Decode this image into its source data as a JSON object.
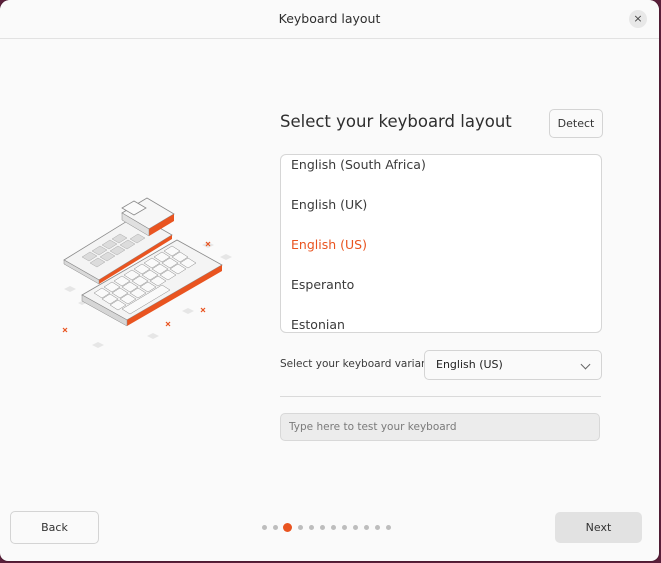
{
  "window": {
    "title": "Keyboard layout",
    "close_glyph": "×"
  },
  "main": {
    "heading": "Select your keyboard layout",
    "detect_label": "Detect",
    "layouts": [
      {
        "label": "English (South Africa)",
        "selected": false
      },
      {
        "label": "English (UK)",
        "selected": false
      },
      {
        "label": "English (US)",
        "selected": true
      },
      {
        "label": "Esperanto",
        "selected": false
      },
      {
        "label": "Estonian",
        "selected": false
      }
    ],
    "variant_label": "Select your keyboard variant:",
    "variant_value": "English (US)",
    "test_placeholder": "Type here to test your keyboard"
  },
  "footer": {
    "back_label": "Back",
    "next_label": "Next",
    "step_count": 12,
    "current_step": 3
  },
  "colors": {
    "accent": "#e95420",
    "window_bg": "#fafafa",
    "desktop_bg": "#5a1f3a"
  },
  "icons": {
    "close": "close-icon",
    "chevron": "chevron-down-icon",
    "illustration": "keyboard-illustration"
  }
}
